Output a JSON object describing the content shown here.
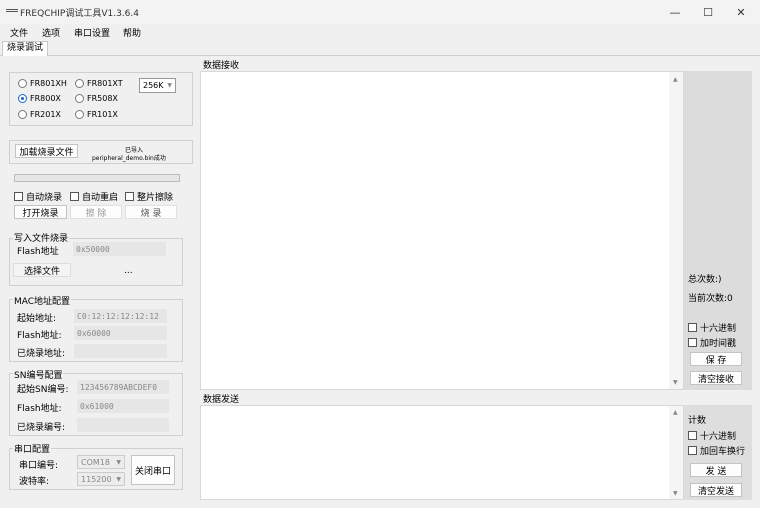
{
  "window": {
    "title": "FREQCHIP调试工具V1.3.6.4",
    "minimize": "—",
    "maximize": "☐",
    "close": "✕"
  },
  "menu": [
    "文件",
    "选项",
    "串口设置",
    "帮助"
  ],
  "tabs": [
    {
      "label": "烧录调试"
    }
  ],
  "chip": {
    "options": [
      "FR801XH",
      "FR801XT",
      "FR800X",
      "FR508X",
      "FR201X",
      "FR101X"
    ],
    "selected": "FR800X",
    "size": "256K"
  },
  "load": {
    "button": "加载烧录文件",
    "status_line1": "已导入",
    "status_line2": "peripheral_demo.bin成功",
    "progress": 0
  },
  "burn": {
    "auto_burn": "自动烧录",
    "auto_restart": "自动重启",
    "full_erase": "整片擦除",
    "open_button": "打开烧录",
    "erase_button": "擦  除",
    "burn_button": "烧  录"
  },
  "write_file": {
    "title": "写入文件烧录",
    "flash_label": "Flash地址",
    "flash_value": "0x50000",
    "select_button": "选择文件",
    "path": "..."
  },
  "mac": {
    "title": "MAC地址配置",
    "start_label": "起始地址:",
    "start_value": "C0:12:12:12:12:12",
    "flash_label": "Flash地址:",
    "flash_value": "0x60000",
    "burned_label": "已烧录地址:",
    "burned_value": ""
  },
  "sn": {
    "title": "SN编号配置",
    "start_label": "起始SN编号:",
    "start_value": "123456789ABCDEF0",
    "flash_label": "Flash地址:",
    "flash_value": "0x61000",
    "burned_label": "已烧录编号:",
    "burned_value": ""
  },
  "serial": {
    "title": "串口配置",
    "port_label": "串口编号:",
    "port_value": "COM18",
    "baud_label": "波特率:",
    "baud_value": "115200",
    "close_button": "关闭串口"
  },
  "receive": {
    "title": "数据接收",
    "total_label": "总次数:)",
    "current_label": "当前次数:0",
    "hex": "十六进制",
    "timestamp": "加时间戳",
    "save_button": "保   存",
    "clear_button": "清空接收"
  },
  "send": {
    "title": "数据发送",
    "count_label": "计数",
    "hex": "十六进制",
    "crlf": "加回车换行",
    "send_button": "发   送",
    "clear_button": "清空发送"
  }
}
